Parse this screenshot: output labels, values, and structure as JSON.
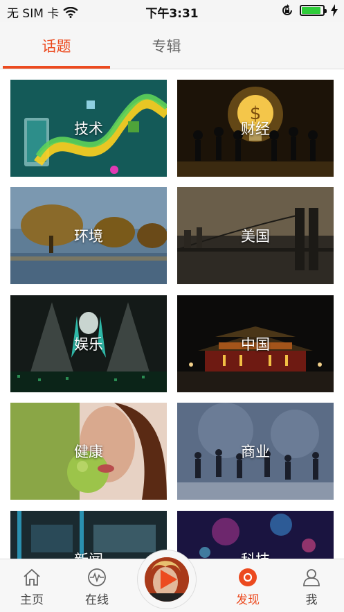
{
  "status_bar": {
    "carrier": "无 SIM 卡",
    "time": "下午3:31",
    "battery_level": 0.9,
    "battery_color": "#2fcc3a"
  },
  "tabs": [
    {
      "label": "话题",
      "active": true
    },
    {
      "label": "专辑",
      "active": false
    }
  ],
  "accent_color": "#ec4a1f",
  "topics": [
    {
      "label": "技术"
    },
    {
      "label": "财经"
    },
    {
      "label": "环境"
    },
    {
      "label": "美国"
    },
    {
      "label": "娱乐"
    },
    {
      "label": "中国"
    },
    {
      "label": "健康"
    },
    {
      "label": "商业"
    },
    {
      "label": "新闻"
    },
    {
      "label": "科技"
    }
  ],
  "bottom_nav": [
    {
      "label": "主页",
      "icon": "home-icon",
      "active": false
    },
    {
      "label": "在线",
      "icon": "pulse-icon",
      "active": false
    },
    {
      "label": "发现",
      "icon": "discover-icon",
      "active": true
    },
    {
      "label": "我",
      "icon": "profile-icon",
      "active": false
    }
  ],
  "center_button": {
    "icon": "play-icon"
  }
}
